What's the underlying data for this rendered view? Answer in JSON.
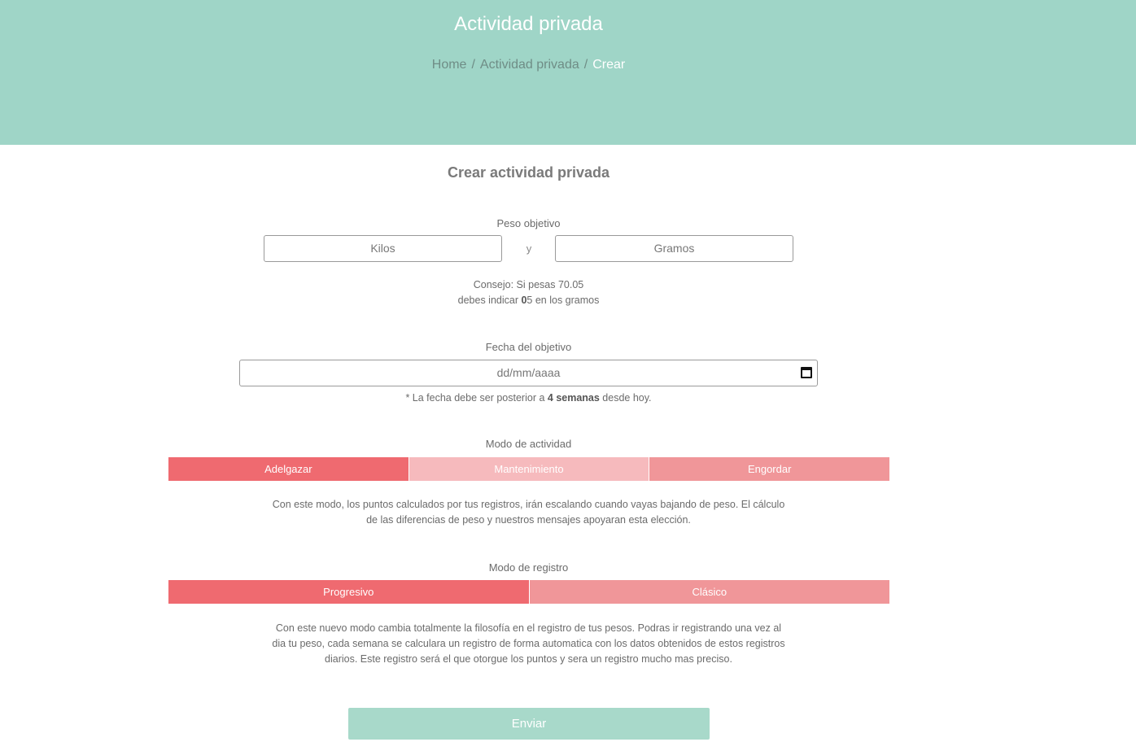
{
  "header": {
    "title": "Actividad privada",
    "breadcrumb": {
      "home": "Home",
      "section": "Actividad privada",
      "current": "Crear",
      "separator": "/"
    },
    "background_color": "#9fd5c7"
  },
  "form": {
    "title": "Crear actividad privada",
    "weight": {
      "label": "Peso objetivo",
      "kilos_placeholder": "Kilos",
      "and_text": "y",
      "gramos_placeholder": "Gramos",
      "hint_line1": "Consejo: Si pesas 70.05",
      "hint_line2_pre": "debes indicar ",
      "hint_line2_bold": "0",
      "hint_line2_post": "5 en los gramos"
    },
    "date": {
      "label": "Fecha del objetivo",
      "placeholder": "dd/mm/aaaa",
      "icon": "calendar-icon",
      "note_pre": "* La fecha debe ser posterior a ",
      "note_bold": "4 semanas",
      "note_post": " desde hoy."
    },
    "activity_mode": {
      "label": "Modo de actividad",
      "options": [
        "Adelgazar",
        "Mantenimiento",
        "Engordar"
      ],
      "selected": "Adelgazar",
      "description_line1": "Con este modo, los puntos calculados por tus registros, irán escalando cuando vayas bajando de peso. El cálculo",
      "description_line2": "de las diferencias de peso y nuestros mensajes apoyaran esta elección."
    },
    "register_mode": {
      "label": "Modo de registro",
      "options": [
        "Progresivo",
        "Clásico"
      ],
      "selected": "Progresivo",
      "description_line1": "Con este nuevo modo cambia totalmente la filosofía en el registro de tus pesos. Podras ir registrando una vez al",
      "description_line2": "dia tu peso, cada semana se calculara un registro de forma automatica con los datos obtenidos de estos registros",
      "description_line3": "diarios. Este registro será el que otorgue los puntos y sera un registro mucho mas preciso."
    },
    "submit_label": "Enviar"
  },
  "colors": {
    "accent_active": "#ef6a70",
    "accent_light": "#f6babd",
    "accent_mid": "#f09699",
    "submit": "#a8d9ca"
  }
}
